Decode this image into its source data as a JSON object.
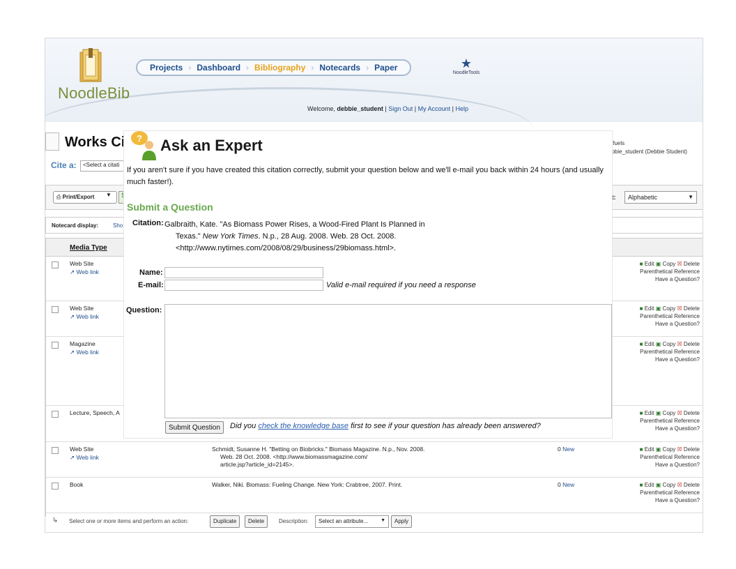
{
  "header": {
    "logo_text": "NoodleBib",
    "nav": [
      "Projects",
      "Dashboard",
      "Bibliography",
      "Notecards",
      "Paper"
    ],
    "active_nav": "Bibliography",
    "noodletools_logo": "NoodleTools",
    "welcome_prefix": "Welcome, ",
    "username": "debbie_student",
    "links": [
      "Sign Out",
      "My Account",
      "Help"
    ]
  },
  "page": {
    "title": "Works Ci",
    "cite_label": "Cite a:",
    "cite_select": "<Select a citati",
    "project_name": "iofuels",
    "project_owner": "ebbie_student (Debbie Student)",
    "print_export": "Print/Export",
    "sort_label": "rt:",
    "sort_value": "Alphabetic",
    "notecard_label": "Notecard display:",
    "notecard_value": "Sho",
    "col_media": "Media Type"
  },
  "rows": [
    {
      "media": "Web Site",
      "link": "Web link",
      "cit": [
        "",
        ""
      ],
      "count": "",
      "new": ""
    },
    {
      "media": "Web Site",
      "link": "Web link",
      "cit": [
        "",
        ""
      ],
      "count": "",
      "new": ""
    },
    {
      "media": "Magazine",
      "link": "Web link",
      "cit": [
        "",
        ""
      ],
      "count": "",
      "new": ""
    },
    {
      "media": "Lecture, Speech, A",
      "link": "",
      "cit": [
        "",
        ""
      ],
      "count": "",
      "new": ""
    },
    {
      "media": "Web Site",
      "link": "Web link",
      "cit": [
        "Schmidt, Susanne H. \"Betting on Biobricks.\" Biomass Magazine. N.p., Nov. 2008.",
        "Web. 28 Oct. 2008. <http://www.biomassmagazine.com/",
        "article.jsp?article_id=2145>."
      ],
      "count": "0",
      "new": "New"
    },
    {
      "media": "Book",
      "link": "",
      "cit": [
        "Walker, Niki. Biomass: Fueling Change. New York: Crabtree, 2007. Print."
      ],
      "count": "0",
      "new": "New"
    }
  ],
  "row_actions": {
    "edit": "Edit",
    "copy": "Copy",
    "delete": "Delete",
    "paren": "Parenthetical Reference",
    "question": "Have a Question?"
  },
  "bottom": {
    "text": "Select one or more items and perform an action:",
    "duplicate": "Duplicate",
    "delete": "Delete",
    "desc_label": "Description:",
    "desc_select": "Select an attribute...",
    "apply": "Apply"
  },
  "modal": {
    "title": "Ask an Expert",
    "intro": "If you aren't sure if you have created this citation correctly, submit your question below and we'll e-mail you back within 24 hours (and usually much faster!).",
    "submit_heading": "Submit a Question",
    "citation_label": "Citation:",
    "citation_line1": "Galbraith, Kate. \"As Biomass Power Rises, a Wood-Fired Plant Is Planned in",
    "citation_line2a": "Texas.\" ",
    "citation_line2_italic": "New York Times",
    "citation_line2b": ". N.p., 28 Aug. 2008. Web. 28 Oct. 2008.",
    "citation_line3": "<http://www.nytimes.com/2008/08/29/business/29biomass.html>.",
    "name_label": "Name:",
    "email_label": "E-mail:",
    "email_note": "Valid e-mail required if you need a response",
    "question_label": "Question:",
    "submit_button": "Submit Question",
    "note_prefix": "Did you ",
    "note_link": "check the knowledge base",
    "note_suffix": " first to see if your question has already been answered?"
  },
  "colors": {
    "nav_blue": "#1e4e8c",
    "nav_active": "#e8a21b",
    "heading_green": "#6aa84f",
    "link_blue": "#2a5db0"
  }
}
